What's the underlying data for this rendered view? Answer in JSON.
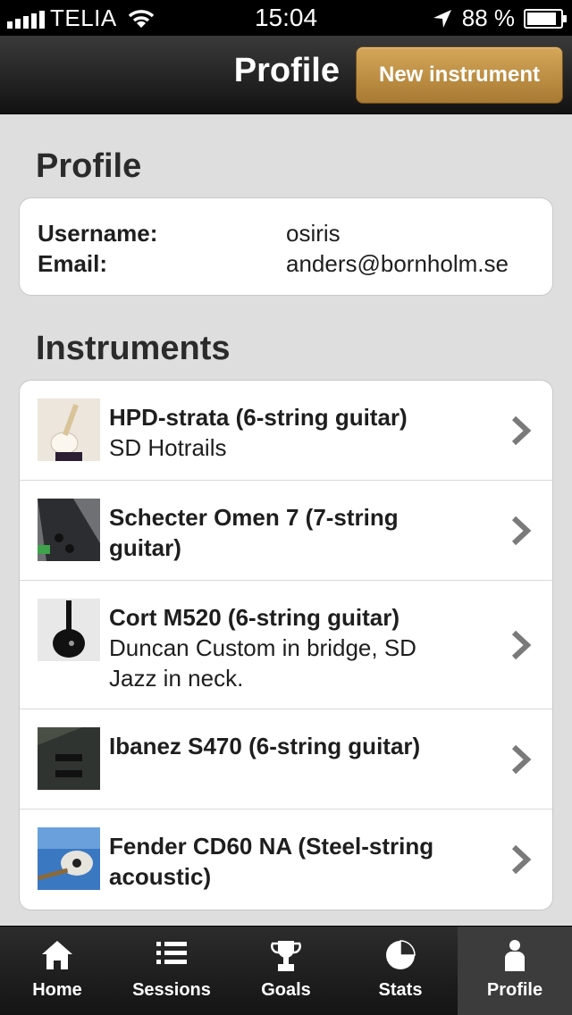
{
  "status_bar": {
    "carrier": "TELIA",
    "time": "15:04",
    "battery": "88 %",
    "battery_level": 0.88,
    "icons": [
      "signal-bars-icon",
      "wifi-icon",
      "location-arrow-icon",
      "battery-icon"
    ]
  },
  "nav": {
    "title": "Profile",
    "new_instrument_label": "New instrument",
    "button_color": "#c1924a"
  },
  "profile": {
    "section_title": "Profile",
    "username_label": "Username:",
    "username_value": "osiris",
    "email_label": "Email:",
    "email_value": "anders@bornholm.se"
  },
  "instruments": {
    "section_title": "Instruments",
    "items": [
      {
        "name": "HPD-strata (6-string guitar)",
        "detail": "SD Hotrails",
        "thumb": "white-stratocaster-photo"
      },
      {
        "name": "Schecter Omen 7 (7-string guitar)",
        "detail": "",
        "thumb": "black-seven-string-photo"
      },
      {
        "name": "Cort M520 (6-string guitar)",
        "detail": "Duncan Custom in bridge, SD Jazz in neck.",
        "thumb": "black-single-cut-guitar-photo"
      },
      {
        "name": "Ibanez S470 (6-string guitar)",
        "detail": "",
        "thumb": "dark-ibanez-guitar-photo"
      },
      {
        "name": "Fender CD60 NA (Steel-string acoustic)",
        "detail": "",
        "thumb": "acoustic-guitar-on-blue-photo"
      }
    ]
  },
  "tabs": [
    {
      "label": "Home",
      "icon": "home-icon",
      "active": false
    },
    {
      "label": "Sessions",
      "icon": "list-icon",
      "active": false
    },
    {
      "label": "Goals",
      "icon": "trophy-icon",
      "active": false
    },
    {
      "label": "Stats",
      "icon": "pie-chart-icon",
      "active": false
    },
    {
      "label": "Profile",
      "icon": "person-icon",
      "active": true
    }
  ]
}
